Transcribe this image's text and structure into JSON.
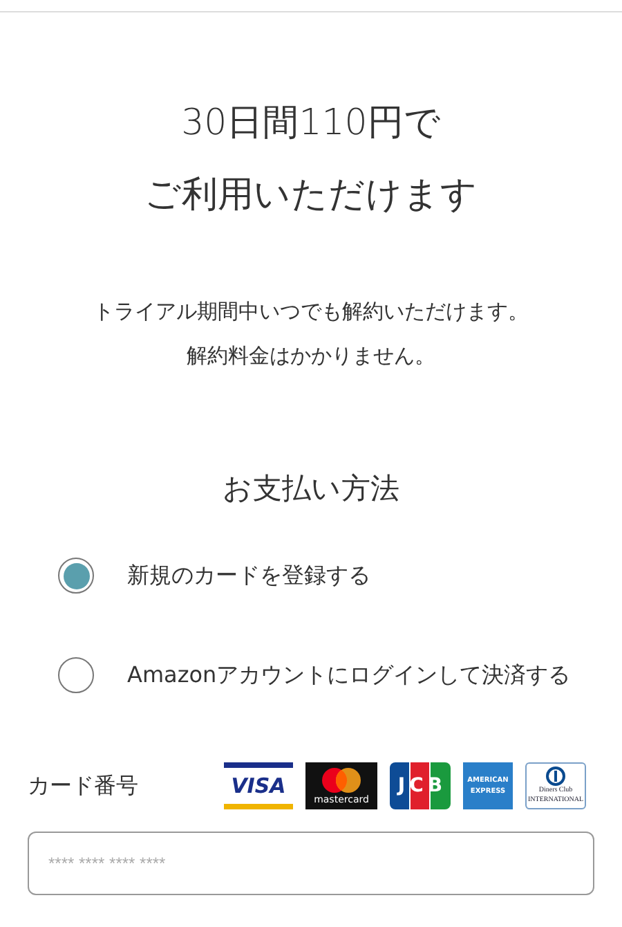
{
  "title_lines": [
    "30日間110円で",
    "ご利用いただけます"
  ],
  "notice_lines": [
    "トライアル期間中いつでも解約いただけます。",
    "解約料金はかかりません。"
  ],
  "payment": {
    "heading": "お支払い方法",
    "options": [
      {
        "label": "新規のカードを登録する",
        "selected": true
      },
      {
        "label": "Amazonアカウントにログインして決済する",
        "selected": false
      }
    ]
  },
  "card": {
    "label": "カード番号",
    "brands": [
      {
        "kind": "visa",
        "text": "VISA"
      },
      {
        "kind": "mastercard",
        "text": "mastercard"
      },
      {
        "kind": "jcb",
        "text": "JCB"
      },
      {
        "kind": "amex",
        "text": "AMERICAN EXPRESS"
      },
      {
        "kind": "diners",
        "text": "Diners Club INTERNATIONAL"
      }
    ],
    "placeholder": "**** **** **** ****"
  }
}
